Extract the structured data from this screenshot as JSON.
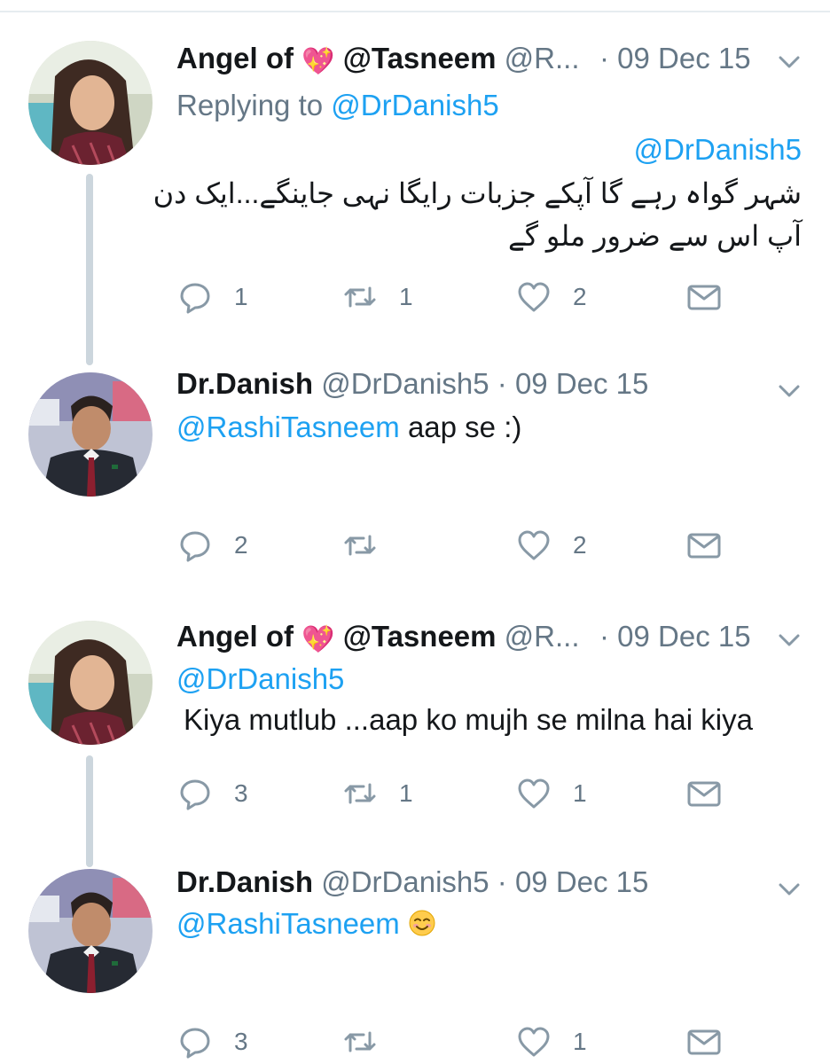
{
  "colors": {
    "link": "#1da1f2",
    "muted": "#657786",
    "text": "#14171a",
    "thread_line": "#ccd6dd",
    "heart": "#e91e63"
  },
  "tweets": [
    {
      "name": "Angel of",
      "name_icon": "sparkling-heart-icon",
      "name_suffix": "@Tasneem",
      "handle": "@R...",
      "date": "· 09 Dec 15",
      "reply_prefix": "Replying to",
      "reply_to": "@DrDanish5",
      "mention": "@DrDanish5",
      "body_line1": "شہر گواہ رہے گا آپکے جزبات رایگا نہی جاینگے...ایک دن",
      "body_line2": "آپ اس سے ضرور ملو گے",
      "counts": {
        "reply": "1",
        "retweet": "1",
        "like": "2"
      }
    },
    {
      "name": "Dr.Danish",
      "handle": "@DrDanish5",
      "date": "· 09 Dec 15",
      "mention": "@RashiTasneem",
      "body": "aap se :)",
      "counts": {
        "reply": "2",
        "retweet": "",
        "like": "2"
      }
    },
    {
      "name": "Angel of",
      "name_icon": "sparkling-heart-icon",
      "name_suffix": "@Tasneem",
      "handle": "@R...",
      "date": "· 09 Dec 15",
      "mention": "@DrDanish5",
      "body": "Kiya mutlub ...aap ko mujh se milna hai kiya",
      "counts": {
        "reply": "3",
        "retweet": "1",
        "like": "1"
      }
    },
    {
      "name": "Dr.Danish",
      "handle": "@DrDanish5",
      "date": "· 09 Dec 15",
      "mention": "@RashiTasneem",
      "body_icon": "smiling-face-emoji",
      "counts": {
        "reply": "3",
        "retweet": "",
        "like": "1"
      }
    }
  ]
}
